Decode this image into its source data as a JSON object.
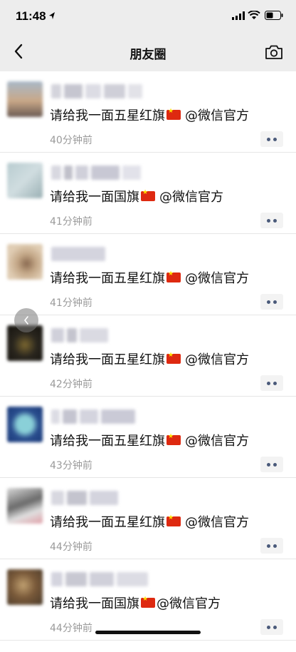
{
  "status_bar": {
    "time": "11:48"
  },
  "nav": {
    "title": "朋友圈"
  },
  "messages": [
    {
      "text": "请给我一面五星红旗",
      "mention": "@微信官方",
      "time": "40分钟前",
      "avatar_colors": [
        "#a8b8c8",
        "#c9a888",
        "#6a5a52"
      ]
    },
    {
      "text": "请给我一面国旗",
      "mention": "@微信官方",
      "time": "41分钟前",
      "avatar_colors": [
        "#b8ccd0",
        "#d0dde0",
        "#9ab0b4"
      ]
    },
    {
      "text": "请给我一面五星红旗",
      "mention": "@微信官方",
      "time": "41分钟前",
      "avatar_colors": [
        "#e0cdb4",
        "#c4a888",
        "#8a6a50"
      ]
    },
    {
      "text": "请给我一面五星红旗",
      "mention": "@微信官方",
      "time": "42分钟前",
      "avatar_colors": [
        "#2a261e",
        "#7a6630",
        "#14120e"
      ]
    },
    {
      "text": "请给我一面五星红旗",
      "mention": "@微信官方",
      "time": "43分钟前",
      "avatar_colors": [
        "#2a4e8e",
        "#8ad0d8",
        "#1a3a7a"
      ]
    },
    {
      "text": "请给我一面五星红旗",
      "mention": "@微信官方",
      "time": "44分钟前",
      "avatar_colors": [
        "#d8d8d8",
        "#6a6a6a",
        "#e0a0a8"
      ]
    },
    {
      "text": "请给我一面国旗",
      "mention": "@微信官方",
      "time": "44分钟前",
      "avatar_colors": [
        "#7a5a3a",
        "#c0a070",
        "#4a3a2a"
      ]
    }
  ],
  "icons": {
    "back": "chevron-left-icon",
    "camera": "camera-icon",
    "more": "more-dots-icon",
    "flag": "china-flag-icon"
  },
  "colors": {
    "nav_bg": "#ededed",
    "link": "#4a5a7a",
    "time_gray": "#9a9a9a",
    "flag_red": "#de2910",
    "flag_star": "#ffde00"
  }
}
